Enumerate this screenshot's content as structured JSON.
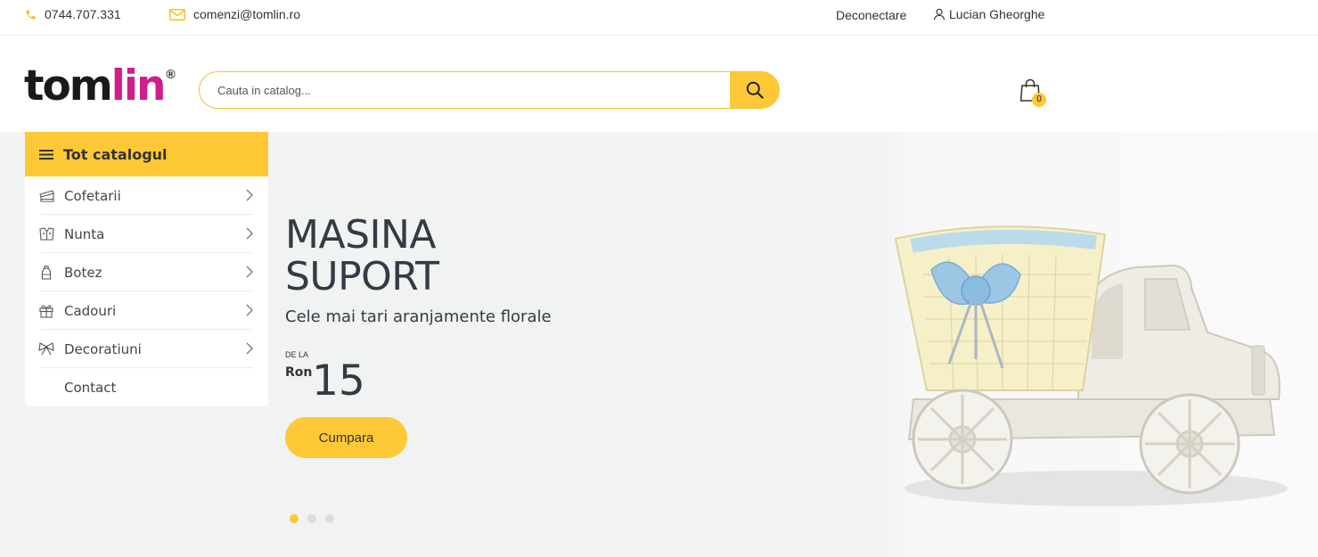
{
  "topbar": {
    "phone": "0744.707.331",
    "email": "comenzi@tomlin.ro",
    "logout": "Deconectare",
    "user": "Lucian Gheorghe"
  },
  "header": {
    "logo_part1": "tom",
    "logo_part2": "lin",
    "logo_reg": "®",
    "search_placeholder": "Cauta in catalog...",
    "cart_count": "0"
  },
  "catalog": {
    "title": "Tot catalogul",
    "items": [
      {
        "label": "Cofetarii",
        "icon": "cake-icon",
        "has_submenu": true
      },
      {
        "label": "Nunta",
        "icon": "wedding-icon",
        "has_submenu": true
      },
      {
        "label": "Botez",
        "icon": "bottle-icon",
        "has_submenu": true
      },
      {
        "label": "Cadouri",
        "icon": "gift-icon",
        "has_submenu": true
      },
      {
        "label": "Decoratiuni",
        "icon": "bow-icon",
        "has_submenu": true
      },
      {
        "label": "Contact",
        "icon": "",
        "has_submenu": false
      }
    ]
  },
  "hero": {
    "title_line1": "MASINA",
    "title_line2": "SUPORT",
    "subtitle": "Cele mai tari aranjamente florale",
    "from_label": "DE LA",
    "currency": "Ron",
    "price": "15",
    "button": "Cumpara",
    "slides": 3,
    "active_slide": 1
  },
  "colors": {
    "accent": "#fec836",
    "brand_pink": "#d11c8a",
    "hero_bg": "#f1f2f2",
    "text_dark": "#343a44"
  }
}
